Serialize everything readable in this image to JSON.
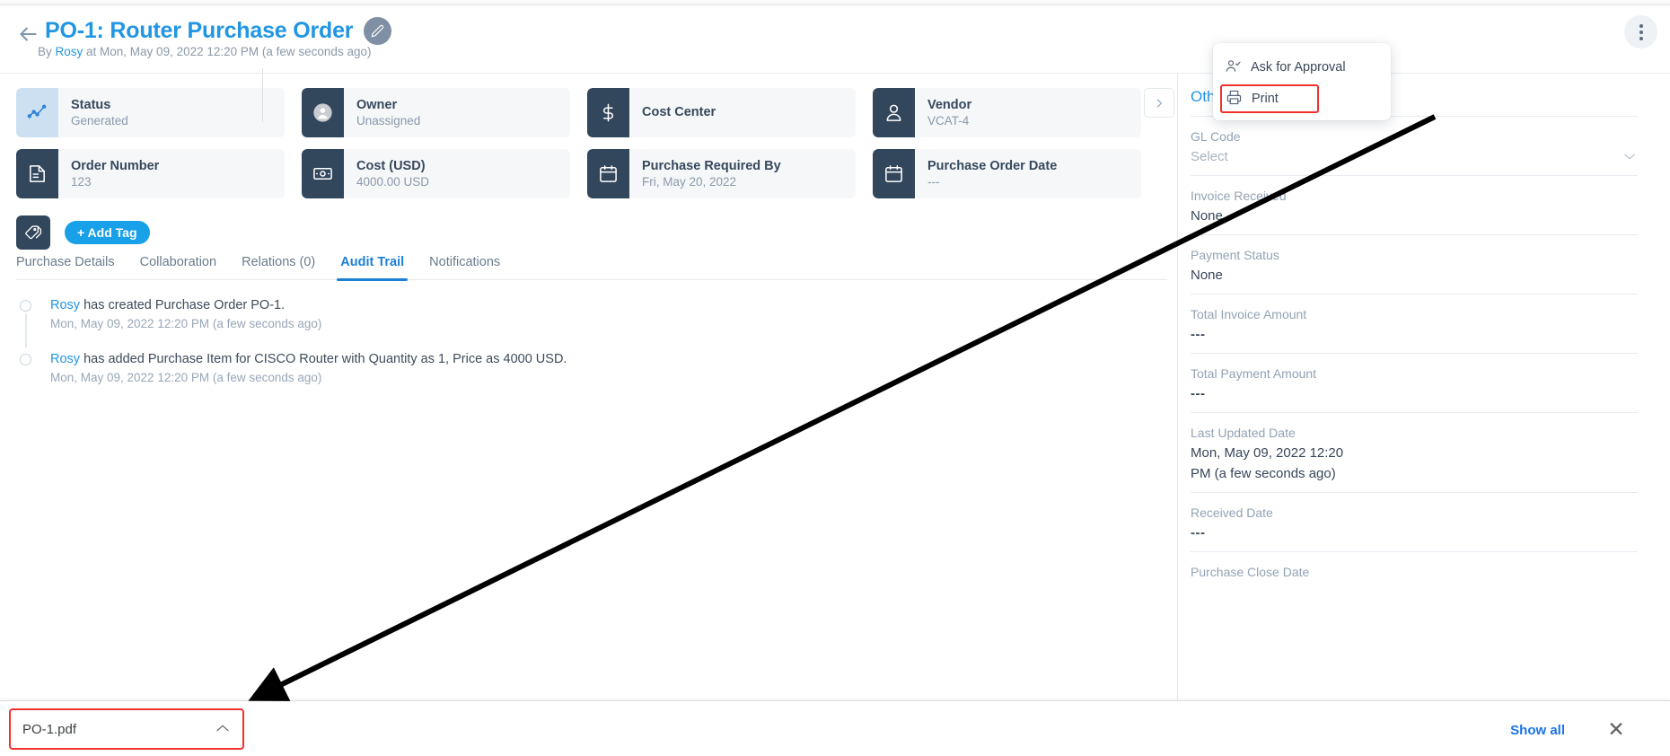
{
  "header": {
    "back_icon": "arrow-left-icon",
    "title": "PO-1: Router Purchase Order",
    "edit_icon": "pencil-icon",
    "byline_prefix": "By ",
    "byline_user": "Rosy",
    "byline_rest": " at Mon, May 09, 2022 12:20 PM (a few seconds ago)",
    "kebab_icon": "more-vertical-icon"
  },
  "menu": {
    "items": [
      {
        "label": "Ask for Approval",
        "icon": "user-check-icon",
        "highlighted": false
      },
      {
        "label": "Print",
        "icon": "printer-icon",
        "highlighted": true
      }
    ]
  },
  "cards": {
    "next_icon": "chevron-right-icon",
    "row1": [
      {
        "label": "Status",
        "value": "Generated",
        "icon": "trend-line-icon",
        "icon_style": "light"
      },
      {
        "label": "Owner",
        "value": "Unassigned",
        "icon": "avatar-circle-icon",
        "icon_style": "dark"
      },
      {
        "label": "Cost Center",
        "value": "",
        "icon": "dollar-icon",
        "icon_style": "dark"
      },
      {
        "label": "Vendor",
        "value": "VCAT-4",
        "icon": "user-icon",
        "icon_style": "dark"
      }
    ],
    "row2": [
      {
        "label": "Order Number",
        "value": "123",
        "icon": "document-icon",
        "icon_style": "dark"
      },
      {
        "label": "Cost (USD)",
        "value": "4000.00 USD",
        "icon": "banknote-icon",
        "icon_style": "dark"
      },
      {
        "label": "Purchase Required By",
        "value": "Fri, May 20, 2022",
        "icon": "calendar-icon",
        "icon_style": "dark"
      },
      {
        "label": "Purchase Order Date",
        "value": "---",
        "icon": "calendar-icon",
        "icon_style": "dark"
      }
    ]
  },
  "tag_row": {
    "tag_icon": "tags-icon",
    "add_tag_label": "+ Add Tag"
  },
  "tabs": [
    {
      "label": "Purchase Details",
      "active": false
    },
    {
      "label": "Collaboration",
      "active": false
    },
    {
      "label": "Relations (0)",
      "active": false
    },
    {
      "label": "Audit Trail",
      "active": true
    },
    {
      "label": "Notifications",
      "active": false
    }
  ],
  "audit_trail": [
    {
      "user": "Rosy",
      "text": " has created Purchase Order PO-1.",
      "time": "Mon, May 09, 2022 12:20 PM (a few seconds ago)"
    },
    {
      "user": "Rosy",
      "text": " has added Purchase Item for CISCO Router with Quantity as 1, Price as 4000 USD.",
      "time": "Mon, May 09, 2022 12:20 PM (a few seconds ago)"
    }
  ],
  "sidebar": {
    "title": "Oth",
    "fields": [
      {
        "label": "GL Code",
        "value": "Select",
        "value_style": "muted",
        "has_chevron": true
      },
      {
        "label": "Invoice Received",
        "value": "None",
        "value_style": "normal",
        "has_chevron": false
      },
      {
        "label": "Payment Status",
        "value": "None",
        "value_style": "normal",
        "has_chevron": false
      },
      {
        "label": "Total Invoice Amount",
        "value": "---",
        "value_style": "dashes",
        "has_chevron": false
      },
      {
        "label": "Total Payment Amount",
        "value": "---",
        "value_style": "dashes",
        "has_chevron": false
      },
      {
        "label": "Last Updated Date",
        "value": "Mon, May 09, 2022 12:20 PM (a few seconds ago)",
        "value_style": "normal",
        "has_chevron": false
      },
      {
        "label": "Received Date",
        "value": "---",
        "value_style": "dashes",
        "has_chevron": false
      },
      {
        "label": "Purchase Close Date",
        "value": "",
        "value_style": "normal",
        "has_chevron": false
      }
    ]
  },
  "download_bar": {
    "file_name": "PO-1.pdf",
    "caret_icon": "chevron-up-icon",
    "show_all_label": "Show all",
    "close_icon": "close-icon"
  },
  "colors": {
    "accent": "#2196e3",
    "dark_card": "#32465c",
    "highlight_red": "#f0312e",
    "tag_blue": "#18a0e8"
  }
}
